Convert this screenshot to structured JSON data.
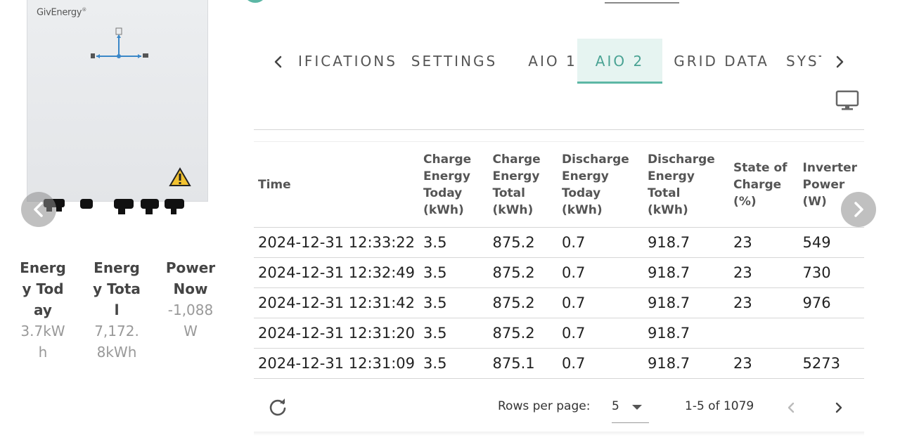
{
  "device": {
    "brand": "GivEnergy",
    "brand_mark": "®"
  },
  "stats": [
    {
      "label": "Energy Today",
      "value": "3.7kWh"
    },
    {
      "label": "Energy Total",
      "value": "7,172.8kWh"
    },
    {
      "label": "Power Now",
      "value": "-1,088 W"
    }
  ],
  "tabs": [
    {
      "label": "NOTIFICATIONS",
      "visible_label": "IFICATIONS",
      "active": false
    },
    {
      "label": "SETTINGS",
      "active": false
    },
    {
      "label": "AIO 1",
      "active": false
    },
    {
      "label": "AIO 2",
      "active": true
    },
    {
      "label": "GRID DATA",
      "active": false
    },
    {
      "label": "SYSTEM",
      "visible_label": "SYST",
      "active": false
    }
  ],
  "table": {
    "headers": [
      "Time",
      "Charge Energy Today (kWh)",
      "Charge Energy Total (kWh)",
      "Discharge Energy Today (kWh)",
      "Discharge Energy Total (kWh)",
      "State of Charge (%)",
      "Inverter Power (W)"
    ],
    "rows": [
      [
        "2024-12-31 12:33:22",
        "3.5",
        "875.2",
        "0.7",
        "918.7",
        "23",
        "549"
      ],
      [
        "2024-12-31 12:32:49",
        "3.5",
        "875.2",
        "0.7",
        "918.7",
        "23",
        "730"
      ],
      [
        "2024-12-31 12:31:42",
        "3.5",
        "875.2",
        "0.7",
        "918.7",
        "23",
        "976"
      ],
      [
        "2024-12-31 12:31:20",
        "3.5",
        "875.2",
        "0.7",
        "918.7",
        "",
        ""
      ],
      [
        "2024-12-31 12:31:09",
        "3.5",
        "875.1",
        "0.7",
        "918.7",
        "23",
        "5273"
      ]
    ]
  },
  "footer": {
    "rows_per_page_label": "Rows per page:",
    "rows_per_page_value": "5",
    "range": "1-5 of 1079"
  },
  "colors": {
    "accent": "#5cb7a5",
    "active_tab_bg": "#e6f4f1"
  }
}
